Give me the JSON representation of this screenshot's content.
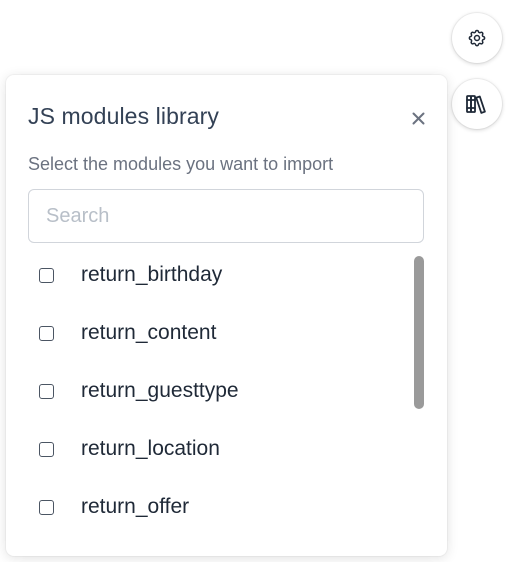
{
  "buttons": {
    "settings_icon": "gear-icon",
    "library_icon": "books-icon"
  },
  "panel": {
    "title": "JS modules library",
    "close_icon": "close-icon",
    "close_glyph": "×",
    "subtitle": "Select the modules you want to import",
    "search": {
      "placeholder": "Search",
      "value": ""
    },
    "modules": [
      {
        "name": "return_birthday",
        "checked": false
      },
      {
        "name": "return_content",
        "checked": false
      },
      {
        "name": "return_guesttype",
        "checked": false
      },
      {
        "name": "return_location",
        "checked": false
      },
      {
        "name": "return_offer",
        "checked": false
      }
    ]
  },
  "colors": {
    "title": "#334155",
    "subtitle": "#6b7280",
    "border": "#d1d5db",
    "scrollbar": "#9a9a9a"
  }
}
